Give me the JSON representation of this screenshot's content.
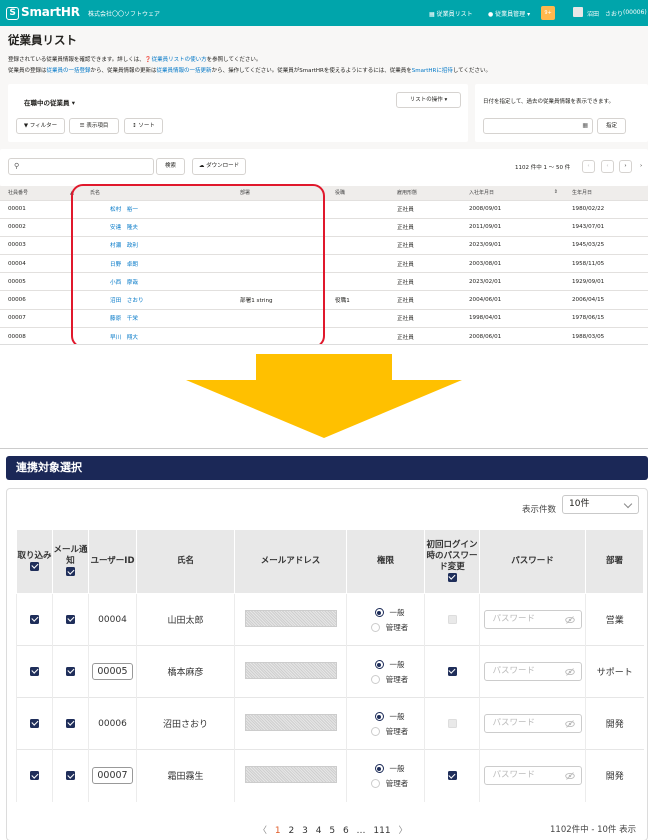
{
  "top": {
    "header": {
      "logo": "SmartHR",
      "company": "株式会社〇〇ソフトウェア",
      "nav_employees": "従業員リスト",
      "nav_manage": "従業員管理",
      "badge": "9+",
      "user_name": "沼田　さおり",
      "user_code": "(00006)"
    },
    "title": "従業員リスト",
    "desc1_a": "登録されている従業員情報を確認できます。詳しくは、",
    "desc1_link": "従業員リストの使い方",
    "desc1_b": "を参照してください。",
    "desc2_a": "従業員の登録は",
    "desc2_link1": "従業員の一括登録",
    "desc2_b": "から、従業員情報の更新は",
    "desc2_link2": "従業員情報の一括更新",
    "desc2_c": "から、操作してください。従業員がSmartHRを使えるようにするには、従業員を",
    "desc2_link3": "SmartHRに招待",
    "desc2_d": "してください。",
    "status_select": "在職中の従業員",
    "list_ops": "リストの操作",
    "btn_filter": "フィルター",
    "btn_columns": "表示項目",
    "btn_sort": "ソート",
    "date_hint": "日付を指定して、過去の従業員情報を表示できます。",
    "btn_specify": "指定",
    "btn_search": "検索",
    "btn_download": "ダウンロード",
    "range": "1102 件中 1 〜 50 件",
    "columns": [
      "社員番号",
      "氏名",
      "部署",
      "役職",
      "雇用形態",
      "入社年月日",
      "生年月日"
    ],
    "rows": [
      {
        "id": "00001",
        "name": "松村　裕一",
        "dept": "",
        "title": "",
        "type": "正社員",
        "joined": "2008/09/01",
        "born": "1980/02/22"
      },
      {
        "id": "00002",
        "name": "安達　隆夫",
        "dept": "",
        "title": "",
        "type": "正社員",
        "joined": "2011/09/01",
        "born": "1943/07/01"
      },
      {
        "id": "00003",
        "name": "村瀬　政利",
        "dept": "",
        "title": "",
        "type": "正社員",
        "joined": "2023/09/01",
        "born": "1945/03/25"
      },
      {
        "id": "00004",
        "name": "日野　卓朗",
        "dept": "",
        "title": "",
        "type": "正社員",
        "joined": "2003/08/01",
        "born": "1958/11/05"
      },
      {
        "id": "00005",
        "name": "小西　摩哉",
        "dept": "",
        "title": "",
        "type": "正社員",
        "joined": "2023/02/01",
        "born": "1929/09/01"
      },
      {
        "id": "00006",
        "name": "沼田　さおり",
        "dept": "部署1  string",
        "title": "役職1",
        "type": "正社員",
        "joined": "2004/06/01",
        "born": "2006/04/15"
      },
      {
        "id": "00007",
        "name": "藤原　千栄",
        "dept": "",
        "title": "",
        "type": "正社員",
        "joined": "1998/04/01",
        "born": "1978/06/15"
      },
      {
        "id": "00008",
        "name": "早川　翔大",
        "dept": "",
        "title": "",
        "type": "正社員",
        "joined": "2008/06/01",
        "born": "1988/03/05"
      }
    ]
  },
  "bottom": {
    "section_title": "連携対象選択",
    "count_label": "表示件数",
    "count_value": "10件",
    "columns": {
      "import": "取り込み",
      "mail": "メール通知",
      "uid": "ユーザーID",
      "name": "氏名",
      "email": "メールアドレス",
      "role": "権限",
      "pwchange": "初回ログイン時のパスワード変更",
      "password": "パスワード",
      "dept": "部署"
    },
    "role_general": "一般",
    "role_admin": "管理者",
    "password_placeholder": "パスワード",
    "rows": [
      {
        "uid": "00004",
        "name": "山田太郎",
        "dept": "営業"
      },
      {
        "uid": "00005",
        "name": "橋本麻彦",
        "dept": "サポート"
      },
      {
        "uid": "00006",
        "name": "沼田さおり",
        "dept": "開発"
      },
      {
        "uid": "00007",
        "name": "霜田霧生",
        "dept": "開発"
      }
    ],
    "pager": {
      "prev": "〈",
      "pages": [
        "1",
        "2",
        "3",
        "4",
        "5",
        "6",
        "…",
        "111"
      ],
      "next": "〉"
    },
    "range_text": "1102件中 - 10件 表示"
  },
  "colors": {
    "brand": "#00a5ab",
    "section": "#1b2857",
    "arrow": "#ffc000",
    "highlight": "#e0182c",
    "link": "#0077c7"
  }
}
